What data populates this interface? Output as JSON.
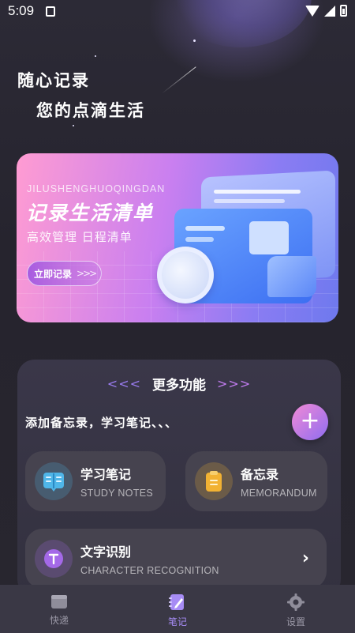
{
  "status_bar": {
    "time": "5:09"
  },
  "hero": {
    "line1": "随心记录",
    "line2": "您的点滴生活"
  },
  "banner": {
    "pinyin": "JILUSHENGHUOQINGDAN",
    "title": "记录生活清单",
    "subtitle": "高效管理  日程清单",
    "cta_label": "立即记录",
    "cta_arrows": ">>>"
  },
  "panel": {
    "deco_left": "<<<",
    "title": "更多功能",
    "deco_right": ">>>",
    "description": "添加备忘录，学习笔记、、、",
    "add_icon": "plus-icon"
  },
  "features": [
    {
      "name": "学习笔记",
      "sub": "STUDY NOTES",
      "icon": "book-icon",
      "icon_color": "#4fb6e8"
    },
    {
      "name": "备忘录",
      "sub": "MEMORANDUM",
      "icon": "memo-icon",
      "icon_color": "#f2b233"
    },
    {
      "name": "文字识别",
      "sub": "CHARACTER RECOGNITION",
      "icon": "text-recognition-icon",
      "icon_color": "#a469e8",
      "chevron": "›"
    }
  ],
  "tabbar": {
    "tabs": [
      {
        "label": "快递",
        "icon": "wallet-icon",
        "active": false
      },
      {
        "label": "笔记",
        "icon": "notebook-pen-icon",
        "active": true
      },
      {
        "label": "设置",
        "icon": "gear-icon",
        "active": false
      }
    ]
  },
  "colors": {
    "accent": "#a78cf5",
    "background": "#24222c",
    "panel": "#3a3749",
    "tabbar": "#3a3845"
  }
}
